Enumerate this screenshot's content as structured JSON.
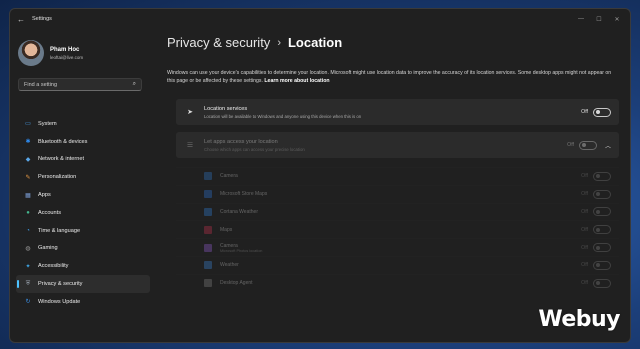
{
  "window": {
    "title": "Settings",
    "controls": [
      "minimize",
      "maximize",
      "close"
    ]
  },
  "profile": {
    "name": "Pham Hoc",
    "email": "leoftai@live.com"
  },
  "search": {
    "placeholder": "Find a setting",
    "icon": "search-icon"
  },
  "sidebar": {
    "items": [
      {
        "label": "System",
        "icon": "monitor-icon",
        "color": "#4aa3f0",
        "active": false
      },
      {
        "label": "Bluetooth & devices",
        "icon": "bluetooth-icon",
        "color": "#2e8bef",
        "active": false
      },
      {
        "label": "Network & internet",
        "icon": "wifi-icon",
        "color": "#5aa7e8",
        "active": false
      },
      {
        "label": "Personalization",
        "icon": "brush-icon",
        "color": "#e89a46",
        "active": false
      },
      {
        "label": "Apps",
        "icon": "apps-icon",
        "color": "#7c9fd8",
        "active": false
      },
      {
        "label": "Accounts",
        "icon": "person-icon",
        "color": "#43b58d",
        "active": false
      },
      {
        "label": "Time & language",
        "icon": "clock-globe-icon",
        "color": "#3f9de8",
        "active": false
      },
      {
        "label": "Gaming",
        "icon": "gamepad-icon",
        "color": "#9a9a9a",
        "active": false
      },
      {
        "label": "Accessibility",
        "icon": "accessibility-icon",
        "color": "#3ea6e6",
        "active": false
      },
      {
        "label": "Privacy & security",
        "icon": "shield-icon",
        "color": "#9aa4b0",
        "active": true
      },
      {
        "label": "Windows Update",
        "icon": "update-icon",
        "color": "#3b8fe6",
        "active": false
      }
    ]
  },
  "breadcrumb": {
    "parent": "Privacy & security",
    "separator": "›",
    "current": "Location"
  },
  "description": {
    "text": "Windows can use your device's capabilities to determine your location. Microsoft might use location data to improve the accuracy of its location services. Some desktop apps might not appear on this page or be affected by these settings.",
    "link": "Learn more about location"
  },
  "location_services": {
    "title": "Location services",
    "subtitle": "Location will be available to Windows and anyone using this device when this is on",
    "state": "Off",
    "icon": "location-arrow-icon"
  },
  "app_access": {
    "title": "Let apps access your location",
    "subtitle": "Choose which apps can access your precise location",
    "state": "Off",
    "icon": "list-icon"
  },
  "apps": [
    {
      "name": "Camera",
      "sub": "",
      "color": "#2f6fb8"
    },
    {
      "name": "Microsoft Store Maps",
      "sub": "",
      "color": "#2b6ec5"
    },
    {
      "name": "Cortana Weather",
      "sub": "",
      "color": "#2e77c9"
    },
    {
      "name": "Maps",
      "sub": "",
      "color": "#b8304a"
    },
    {
      "name": "Camera",
      "sub": "Microsoft Photos location",
      "color": "#8a57c2"
    },
    {
      "name": "Weather",
      "sub": "",
      "color": "#3a7ec8"
    },
    {
      "name": "Desktop Agent",
      "sub": "",
      "color": "#7a7a7a"
    }
  ],
  "watermark": "Webuy"
}
